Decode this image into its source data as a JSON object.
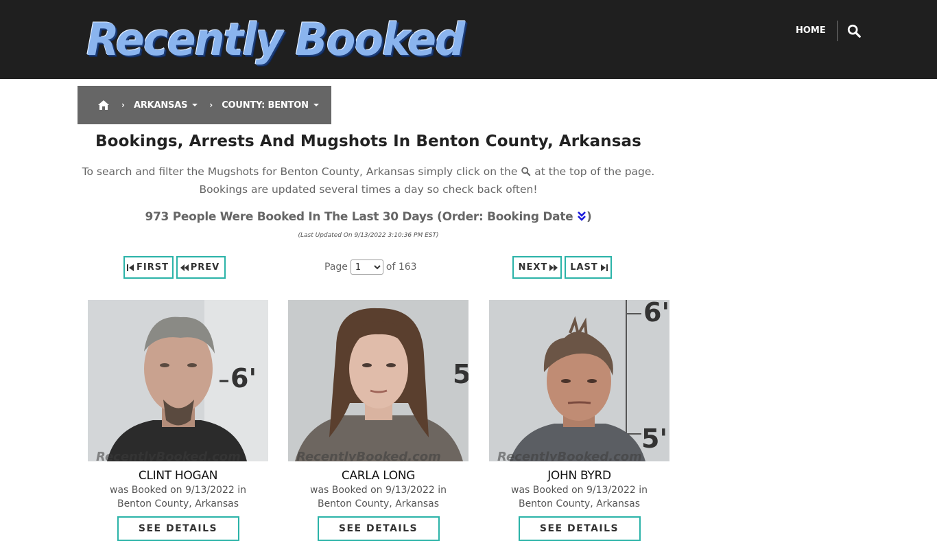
{
  "header": {
    "logo_text": "Recently Booked",
    "nav_home": "HOME",
    "search_icon": "search-icon"
  },
  "breadcrumb": {
    "home_icon": "home-icon",
    "state": "ARKANSAS",
    "county": "COUNTY: BENTON"
  },
  "main": {
    "title": "Bookings, Arrests And Mugshots In Benton County, Arkansas",
    "intro_line1_a": "To search and filter the Mugshots for Benton County, Arkansas simply click on the",
    "intro_line1_b": "at the top of the page.",
    "intro_line2": "Bookings are updated several times a day so check back often!",
    "booked_count": "973 People Were Booked In The Last 30 Days (Order: Booking Date",
    "booked_count_close": ")",
    "last_updated": "(Last Updated On 9/13/2022 3:10:36 PM EST)"
  },
  "pager": {
    "first": "FIRST",
    "prev": "PREV",
    "next": "NEXT",
    "last": "LAST",
    "page_label": "Page",
    "current_page": "1",
    "of_label": "of 163"
  },
  "bookings": [
    {
      "name": "CLINT HOGAN",
      "line1": "was Booked on 9/13/2022 in",
      "line2": "Benton County, Arkansas",
      "button": "SEE DETAILS"
    },
    {
      "name": "CARLA LONG",
      "line1": "was Booked on 9/13/2022 in",
      "line2": "Benton County, Arkansas",
      "button": "SEE DETAILS"
    },
    {
      "name": "JOHN BYRD",
      "line1": "was Booked on 9/13/2022 in",
      "line2": "Benton County, Arkansas",
      "button": "SEE DETAILS"
    }
  ],
  "mugshot_watermark": "RecentlyBooked.com",
  "colors": {
    "header_bg": "#1f1f1f",
    "breadcrumb_bg": "#666666",
    "accent": "#2bb3a8"
  }
}
